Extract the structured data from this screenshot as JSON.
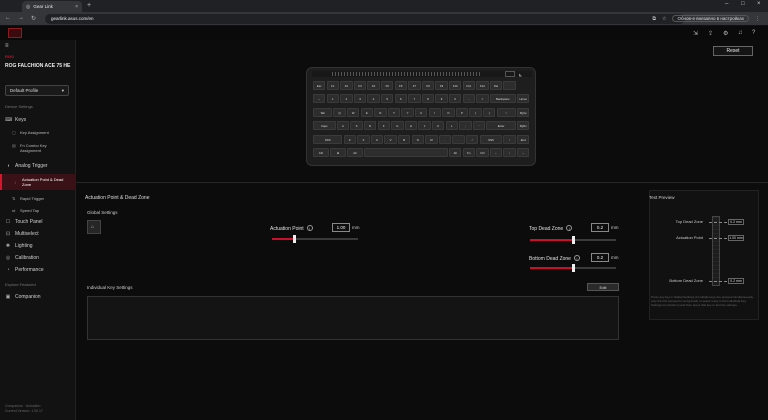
{
  "browser": {
    "tab_title": "Gear Link",
    "url": "gearlink.asus.com/en",
    "profile_label": "Обнов-е внезапно в настройках"
  },
  "app": {
    "brand": "ROG",
    "device_name": "ROG FALCHION ACE 75 HE",
    "profile_select": "Default Profile",
    "reset_label": "Reset"
  },
  "sidebar": {
    "device_settings_label": "Device Settings",
    "items": [
      {
        "label": "Keys",
        "icon": "keyboard-icon"
      },
      {
        "label": "Key Assignment",
        "icon": "key-assign-icon",
        "sub": true
      },
      {
        "label": "Fn Combo Key Assignment",
        "icon": "fn-combo-icon",
        "sub": true
      },
      {
        "label": "Analog Trigger",
        "icon": "analog-trigger-icon"
      },
      {
        "label": "Actuation Point & Dead Zone",
        "icon": "actuation-icon",
        "sub": true,
        "active": true
      },
      {
        "label": "Rapid Trigger",
        "icon": "rapid-trigger-icon",
        "sub": true
      },
      {
        "label": "Speed Tap",
        "icon": "speed-tap-icon",
        "sub": true
      },
      {
        "label": "Touch Panel",
        "icon": "touch-panel-icon"
      },
      {
        "label": "Multiselect",
        "icon": "multiselect-icon"
      },
      {
        "label": "Lighting",
        "icon": "lighting-icon"
      },
      {
        "label": "Calibration",
        "icon": "calibration-icon"
      },
      {
        "label": "Performance",
        "icon": "performance-icon"
      }
    ],
    "explore_label": "Explore Featured",
    "companion_label": "Companion",
    "version_line1": "Companion · Actuation",
    "version_line2": "Current Version: 1.00.17"
  },
  "main": {
    "section_title": "Actuation Point & Dead Zone",
    "global_settings_label": "Global Settings",
    "actuation_point": {
      "label": "Actuation Point",
      "value": "1.00",
      "unit": "mm",
      "fraction": 0.25
    },
    "top_dead_zone": {
      "label": "Top Dead Zone",
      "value": "0.2",
      "unit": "mm",
      "fraction": 0.5
    },
    "bottom_dead_zone": {
      "label": "Bottom Dead Zone",
      "value": "0.2",
      "unit": "mm",
      "fraction": 0.5
    },
    "individual_key_settings_label": "Individual Key Settings",
    "edit_label": "Edit"
  },
  "test_preview": {
    "title": "Test Preview",
    "top_dead_zone_label": "Top Dead Zone",
    "top_dead_zone_value": "0.2 mm",
    "actuation_point_label": "Actuation Point",
    "actuation_point_value": "1.00 mm",
    "bottom_dead_zone_label": "Bottom Dead Zone",
    "bottom_dead_zone_value": "0.2 mm",
    "note": "Press any key in Global Settings (if multiple keys are pressed simultaneously, only the first pressed is recognized) or select a key in the Individual Key Settings tool (bottom) and then press that key to test the settings."
  },
  "keyboard": {
    "rows": [
      [
        "Esc",
        "F1",
        "F2",
        "F3",
        "F4",
        "F5",
        "F6",
        "F7",
        "F8",
        "F9",
        "F10",
        "F11",
        "F12",
        "Del",
        ""
      ],
      [
        "~",
        "1",
        "2",
        "3",
        "4",
        "5",
        "6",
        "7",
        "8",
        "9",
        "0",
        "-",
        "=",
        "Backspace",
        "Home"
      ],
      [
        "Tab",
        "Q",
        "W",
        "E",
        "R",
        "T",
        "Y",
        "U",
        "I",
        "O",
        "P",
        "[",
        "]",
        "\\",
        "PgUp"
      ],
      [
        "Caps",
        "A",
        "S",
        "D",
        "F",
        "G",
        "H",
        "J",
        "K",
        "L",
        ";",
        "'",
        "Enter",
        "PgDn"
      ],
      [
        "Shift",
        "Z",
        "X",
        "C",
        "V",
        "B",
        "N",
        "M",
        ",",
        ".",
        "/",
        "Shift",
        "↑",
        "End"
      ],
      [
        "Ctrl",
        "⊞",
        "Alt",
        "",
        "Alt",
        "Fn",
        "Ctrl",
        "←",
        "↓",
        "→"
      ]
    ]
  },
  "colors": {
    "accent": "#c8102e",
    "background": "#0c0c0c"
  }
}
